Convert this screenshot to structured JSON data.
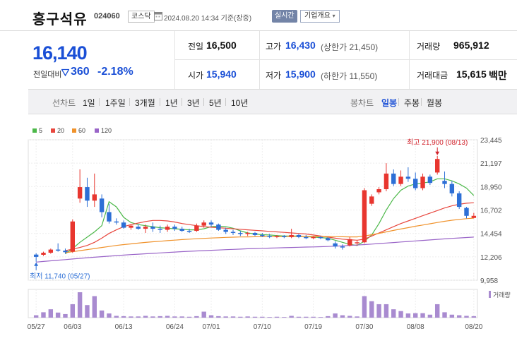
{
  "header": {
    "name": "흥구석유",
    "code": "024060",
    "market": "코스닥",
    "timestamp": "2024.08.20 14:34 기준(장중)",
    "realtime_label": "실시간",
    "company_label": "기업개요"
  },
  "quote": {
    "price": "16,140",
    "change_label": "전일대비",
    "change": "360",
    "change_pct": "-2.18%",
    "change_direction": "down",
    "prev_label": "전일",
    "prev_value": "16,500",
    "high_label": "고가",
    "high_value": "16,430",
    "upper_limit": "(상한가 21,450)",
    "volume_label": "거래량",
    "volume_value": "965,912",
    "open_label": "시가",
    "open_value": "15,940",
    "low_label": "저가",
    "low_value": "15,900",
    "lower_limit": "(하한가 11,550)",
    "amount_label": "거래대금",
    "amount_value": "15,615",
    "amount_unit": "백만",
    "down_color": "#1a4fd6"
  },
  "periods": {
    "line_title": "선차트",
    "line_items": [
      "1일",
      "1주일",
      "3개월",
      "1년",
      "3년",
      "5년",
      "10년"
    ],
    "candle_title": "봉차트",
    "candle_items": [
      "일봉",
      "주봉",
      "월봉"
    ],
    "active_candle": "일봉"
  },
  "chart_data": {
    "type": "candlestick",
    "legend": [
      {
        "name": "5",
        "color": "#4cb849"
      },
      {
        "name": "20",
        "color": "#e8473e"
      },
      {
        "name": "60",
        "color": "#f0922b"
      },
      {
        "name": "120",
        "color": "#9a65c8"
      }
    ],
    "y_ticks": [
      "23,445",
      "21,197",
      "18,950",
      "16,702",
      "14,454",
      "12,206",
      "9,958"
    ],
    "ylim": [
      9958,
      23445
    ],
    "x_ticks": [
      {
        "label": "05/27",
        "i": 0
      },
      {
        "label": "06/03",
        "i": 5
      },
      {
        "label": "06/13",
        "i": 12
      },
      {
        "label": "06/24",
        "i": 19
      },
      {
        "label": "07/01",
        "i": 24
      },
      {
        "label": "07/10",
        "i": 31
      },
      {
        "label": "07/19",
        "i": 38
      },
      {
        "label": "07/30",
        "i": 45
      },
      {
        "label": "08/08",
        "i": 52
      },
      {
        "label": "08/20",
        "i": 60
      }
    ],
    "high_annotation": "최고 21,900 (08/13)",
    "low_annotation": "최저 11,740 (05/27)",
    "volume_label": "거래량",
    "up_color": "#e8362f",
    "down_color": "#2d6fd6",
    "volume_color": "#a98bd0",
    "candles": [
      [
        12420,
        12550,
        11740,
        12200
      ],
      [
        12400,
        12700,
        12300,
        12600
      ],
      [
        12600,
        13000,
        12500,
        12900
      ],
      [
        12900,
        13500,
        12700,
        12800
      ],
      [
        12800,
        13000,
        12500,
        12650
      ],
      [
        12700,
        15800,
        12600,
        15600
      ],
      [
        17800,
        20600,
        17400,
        18900
      ],
      [
        18900,
        19800,
        17000,
        17600
      ],
      [
        17600,
        20200,
        17000,
        18200
      ],
      [
        17800,
        18200,
        16000,
        16500
      ],
      [
        16500,
        17300,
        15400,
        15600
      ],
      [
        15600,
        15900,
        15300,
        15500
      ],
      [
        15500,
        15700,
        14900,
        15000
      ],
      [
        15000,
        15300,
        14800,
        15200
      ],
      [
        15100,
        15300,
        14800,
        14900
      ],
      [
        14900,
        15300,
        14500,
        15100
      ],
      [
        15100,
        15500,
        14600,
        14900
      ],
      [
        14900,
        15200,
        14500,
        14800
      ],
      [
        14800,
        15300,
        14600,
        15100
      ],
      [
        15100,
        15300,
        14700,
        14900
      ],
      [
        14900,
        15100,
        14600,
        14700
      ],
      [
        14700,
        14900,
        14500,
        14600
      ],
      [
        14700,
        15400,
        14600,
        15200
      ],
      [
        15200,
        15700,
        15000,
        15500
      ],
      [
        15500,
        15700,
        15100,
        15300
      ],
      [
        15300,
        15400,
        14700,
        14800
      ],
      [
        14800,
        15000,
        14400,
        14600
      ],
      [
        14600,
        14800,
        14300,
        14500
      ],
      [
        14500,
        14700,
        14200,
        14400
      ],
      [
        14400,
        14600,
        14200,
        14500
      ],
      [
        14500,
        14600,
        14200,
        14300
      ],
      [
        14300,
        14500,
        14100,
        14200
      ],
      [
        14200,
        14400,
        14000,
        14100
      ],
      [
        14100,
        14300,
        14000,
        14200
      ],
      [
        14200,
        14300,
        14000,
        14100
      ],
      [
        14100,
        14900,
        14000,
        14300
      ],
      [
        14300,
        14400,
        14000,
        14100
      ],
      [
        14100,
        14300,
        13900,
        14000
      ],
      [
        14000,
        14200,
        13900,
        14100
      ],
      [
        14100,
        14200,
        13900,
        14000
      ],
      [
        14000,
        14100,
        13700,
        13800
      ],
      [
        13500,
        13700,
        13000,
        13200
      ],
      [
        13200,
        13400,
        12900,
        13100
      ],
      [
        13300,
        14100,
        13200,
        13900
      ],
      [
        13500,
        13800,
        13300,
        13600
      ],
      [
        13600,
        18800,
        13500,
        18600
      ],
      [
        17300,
        18200,
        17100,
        18000
      ],
      [
        18400,
        18900,
        18200,
        18700
      ],
      [
        18700,
        21200,
        18500,
        20200
      ],
      [
        20200,
        20600,
        19000,
        19200
      ],
      [
        19200,
        20500,
        19000,
        19900
      ],
      [
        19900,
        20800,
        19400,
        19700
      ],
      [
        19700,
        20300,
        18600,
        18800
      ],
      [
        18800,
        20200,
        18600,
        19900
      ],
      [
        19900,
        20100,
        19100,
        19300
      ],
      [
        20300,
        21900,
        20100,
        21600
      ],
      [
        19500,
        20400,
        18800,
        19200
      ],
      [
        19200,
        19500,
        18000,
        18300
      ],
      [
        18300,
        18500,
        16800,
        17000
      ],
      [
        16900,
        17000,
        15900,
        16140
      ],
      [
        15940,
        16430,
        15900,
        16140
      ]
    ],
    "volumes": [
      8,
      18,
      28,
      17,
      12,
      45,
      85,
      42,
      72,
      24,
      14,
      6,
      5,
      4,
      4,
      6,
      4,
      5,
      6,
      4,
      4,
      3,
      5,
      20,
      8,
      5,
      4,
      4,
      3,
      4,
      3,
      3,
      2,
      3,
      2,
      6,
      3,
      3,
      3,
      2,
      5,
      14,
      8,
      6,
      4,
      72,
      55,
      45,
      45,
      28,
      22,
      14,
      15,
      15,
      10,
      45,
      18,
      10,
      8,
      6,
      5
    ],
    "ma5": [
      null,
      null,
      null,
      null,
      12500,
      13000,
      13600,
      14100,
      14600,
      15200,
      17500,
      17000,
      16000,
      15500,
      15300,
      15200,
      15100,
      15000,
      14950,
      14900,
      14850,
      14800,
      14800,
      14900,
      15100,
      15150,
      15100,
      14950,
      14700,
      14500,
      14400,
      14330,
      14300,
      14250,
      14200,
      14200,
      14200,
      14150,
      14100,
      14050,
      14000,
      13800,
      13600,
      13400,
      13300,
      13700,
      14300,
      15400,
      16700,
      17800,
      18600,
      19000,
      19200,
      19300,
      19400,
      19700,
      19700,
      19500,
      19200,
      18800,
      18100
    ],
    "ma20": [
      null,
      null,
      null,
      null,
      12800,
      12950,
      13100,
      13300,
      13600,
      14000,
      14450,
      14800,
      15100,
      15300,
      15450,
      15600,
      15700,
      15700,
      15650,
      15550,
      15400,
      15300,
      15200,
      15100,
      15050,
      15000,
      14950,
      14900,
      14850,
      14800,
      14750,
      14700,
      14650,
      14600,
      14550,
      14500,
      14450,
      14400,
      14300,
      14200,
      14100,
      14000,
      13900,
      13850,
      13800,
      13900,
      14200,
      14500,
      14800,
      15100,
      15400,
      15650,
      15900,
      16150,
      16400,
      16650,
      16900,
      17100,
      17250,
      17350,
      17400
    ],
    "ma60": [
      null,
      null,
      null,
      null,
      12600,
      12700,
      12800,
      12900,
      13000,
      13100,
      13200,
      13300,
      13380,
      13450,
      13520,
      13590,
      13650,
      13700,
      13760,
      13810,
      13860,
      13900,
      13940,
      13980,
      14010,
      14040,
      14070,
      14090,
      14110,
      14120,
      14130,
      14140,
      14150,
      14155,
      14160,
      14160,
      14160,
      14160,
      14160,
      14160,
      14150,
      14140,
      14130,
      14120,
      14120,
      14200,
      14330,
      14460,
      14600,
      14740,
      14880,
      15010,
      15140,
      15260,
      15380,
      15500,
      15620,
      15720,
      15800,
      15870,
      15920
    ],
    "ma120": [
      11700,
      11760,
      11820,
      11880,
      11940,
      12000,
      12060,
      12120,
      12170,
      12220,
      12270,
      12320,
      12370,
      12420,
      12460,
      12500,
      12540,
      12580,
      12620,
      12660,
      12700,
      12740,
      12770,
      12800,
      12830,
      12860,
      12890,
      12920,
      12950,
      12980,
      13000,
      13020,
      13040,
      13060,
      13080,
      13100,
      13120,
      13140,
      13160,
      13180,
      13200,
      13230,
      13260,
      13300,
      13340,
      13380,
      13430,
      13480,
      13530,
      13580,
      13630,
      13680,
      13730,
      13780,
      13830,
      13880,
      13930,
      13980,
      14020,
      14060,
      14100
    ]
  }
}
